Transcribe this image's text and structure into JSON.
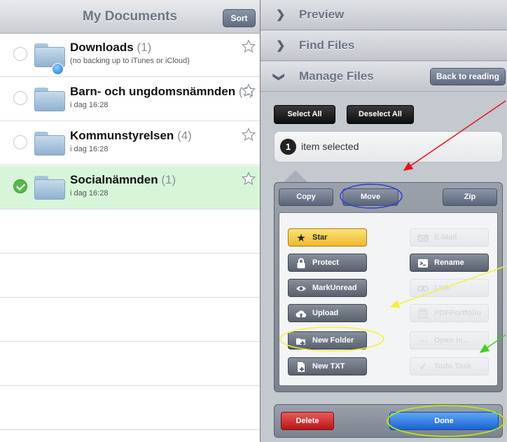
{
  "left": {
    "title": "My Documents",
    "sort_label": "Sort",
    "documents": [
      {
        "name": "Downloads",
        "count": "(1)",
        "subtitle": "(no backing up to iTunes or iCloud)",
        "selected": false
      },
      {
        "name": "Barn- och ungdomsnämnden",
        "count": "(1)",
        "subtitle": "i dag 16:28",
        "selected": false
      },
      {
        "name": "Kommunstyrelsen",
        "count": "(4)",
        "subtitle": "i dag 16:28",
        "selected": false
      },
      {
        "name": "Socialnämnden",
        "count": "(1)",
        "subtitle": "i dag 16:28",
        "selected": true
      }
    ]
  },
  "right": {
    "accordion": {
      "preview": "Preview",
      "find_files": "Find Files",
      "manage_files": "Manage Files",
      "back_to_reading": "Back to reading"
    },
    "select_all": "Select All",
    "deselect_all": "Deselect All",
    "selection": {
      "count": "1",
      "text": "item selected"
    },
    "popover": {
      "copy": "Copy",
      "move": "Move",
      "zip": "Zip",
      "actions_left": [
        {
          "label": "Star",
          "icon": "star-icon",
          "style": "yellow"
        },
        {
          "label": "Protect",
          "icon": "lock-icon",
          "style": "dark"
        },
        {
          "label": "MarkUnread",
          "icon": "eye-icon",
          "style": "dark"
        },
        {
          "label": "Upload",
          "icon": "cloud-upload-icon",
          "style": "dark"
        },
        {
          "label": "New Folder",
          "icon": "new-folder-icon",
          "style": "dark"
        },
        {
          "label": "New TXT",
          "icon": "new-file-icon",
          "style": "dark"
        }
      ],
      "actions_right": [
        {
          "label": "E-Mail",
          "icon": "mail-icon",
          "style": "disabled"
        },
        {
          "label": "Rename",
          "icon": "rename-icon",
          "style": "dark"
        },
        {
          "label": "Link",
          "icon": "link-icon",
          "style": "disabled"
        },
        {
          "label": "PDFPortfolio",
          "icon": "portfolio-icon",
          "style": "disabled"
        },
        {
          "label": "Open In...",
          "icon": "ellipsis-icon",
          "style": "disabled"
        },
        {
          "label": "Todo Task",
          "icon": "checkmark-icon",
          "style": "disabled"
        }
      ]
    },
    "delete": "Delete",
    "done": "Done"
  },
  "colors": {
    "selected_row": "#d7f6d9",
    "star_button": "#f0b82c",
    "delete_button": "#b81616",
    "done_button": "#1c62d3",
    "annotation_red": "#e8101a",
    "annotation_blue": "#2b3fd8",
    "annotation_yellow": "#f4f03a",
    "annotation_green": "#3ad21a"
  }
}
